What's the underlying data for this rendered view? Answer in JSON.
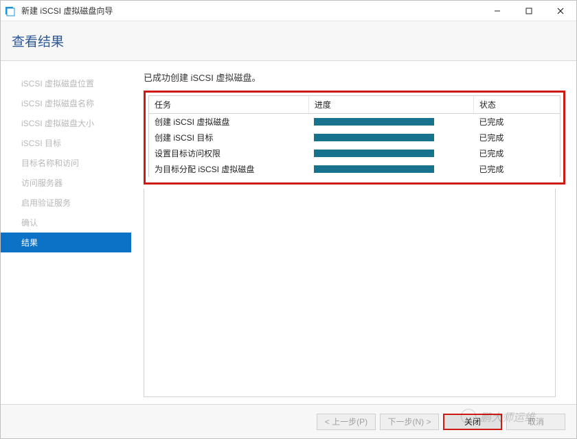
{
  "window": {
    "title": "新建 iSCSI 虚拟磁盘向导"
  },
  "header": {
    "title": "查看结果"
  },
  "sidebar": {
    "items": [
      {
        "label": "iSCSI 虚拟磁盘位置",
        "active": false
      },
      {
        "label": "iSCSI 虚拟磁盘名称",
        "active": false
      },
      {
        "label": "iSCSI 虚拟磁盘大小",
        "active": false
      },
      {
        "label": "iSCSI 目标",
        "active": false
      },
      {
        "label": "目标名称和访问",
        "active": false
      },
      {
        "label": "访问服务器",
        "active": false
      },
      {
        "label": "启用验证服务",
        "active": false
      },
      {
        "label": "确认",
        "active": false
      },
      {
        "label": "结果",
        "active": true
      }
    ]
  },
  "content": {
    "message": "已成功创建 iSCSI 虚拟磁盘。",
    "columns": {
      "task": "任务",
      "progress": "进度",
      "status": "状态"
    },
    "rows": [
      {
        "task": "创建 iSCSI 虚拟磁盘",
        "status": "已完成",
        "progress": 100
      },
      {
        "task": "创建 iSCSI 目标",
        "status": "已完成",
        "progress": 100
      },
      {
        "task": "设置目标访问权限",
        "status": "已完成",
        "progress": 100
      },
      {
        "task": "为目标分配 iSCSI 虚拟磁盘",
        "status": "已完成",
        "progress": 100
      }
    ]
  },
  "footer": {
    "prev": "< 上一步(P)",
    "next": "下一步(N) >",
    "close": "关闭",
    "cancel": "取消"
  },
  "watermark": "鹏大师运维",
  "colors": {
    "accent": "#0b72c5",
    "progress": "#17728e",
    "highlight_border": "#cf1a13"
  }
}
